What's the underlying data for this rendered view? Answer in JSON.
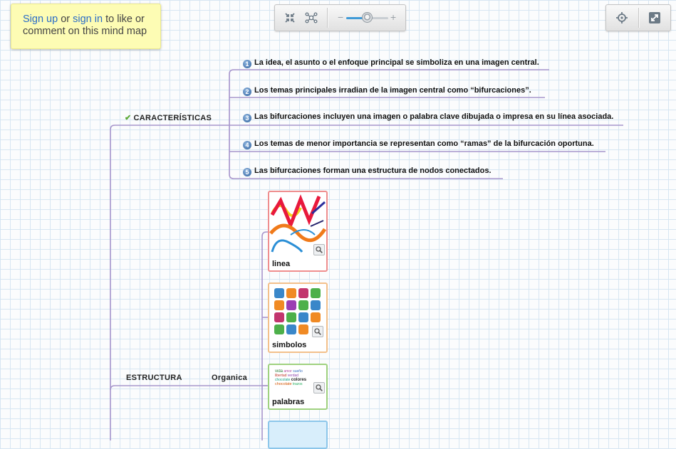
{
  "signup": {
    "sign_up_link": "Sign up",
    "or_text": " or ",
    "sign_in_link": "sign in",
    "rest_text": " to like or comment on this mind map"
  },
  "toolbar": {
    "zoom": {
      "minus": "−",
      "plus": "+",
      "level": 0.5
    }
  },
  "map": {
    "caracteristicas": {
      "label": "CARACTERÍSTICAS",
      "items": [
        {
          "number": "1",
          "text": "La idea, el asunto o el enfoque principal se simboliza en una imagen central."
        },
        {
          "number": "2",
          "text": "Los temas principales irradian de la imagen central como “bifurcaciones”."
        },
        {
          "number": "3",
          "text": "Las bifurcaciones incluyen una imagen o palabra clave dibujada o impresa en su línea asociada."
        },
        {
          "number": "4",
          "text": "Los temas de menor importancia se representan como “ramas” de la bifurcación oportuna."
        },
        {
          "number": "5",
          "text": "Las bifurcaciones forman una estructura de nodos conectados."
        }
      ]
    },
    "estructura": {
      "label": "ESTRUCTURA",
      "child": "Organica",
      "cards": [
        {
          "caption": "linea",
          "border": "#ef8e8e"
        },
        {
          "caption": "simbolos",
          "border": "#f3c08a"
        },
        {
          "caption": "palabras",
          "border": "#9fd17f"
        },
        {
          "caption": "",
          "border": "#8cc6ea"
        }
      ],
      "word_cloud": [
        "vida",
        "amor",
        "colores",
        "verdad",
        "chocolate",
        "trazos",
        "libertad",
        "sueño"
      ]
    }
  },
  "colors": {
    "branch": "#a896cc",
    "link": "#2a6cc7",
    "note": "#fdfcb4"
  },
  "icons": [
    "collapse-icon",
    "network-icon",
    "target-icon",
    "fullscreen-icon",
    "check-icon",
    "magnify-icon"
  ]
}
